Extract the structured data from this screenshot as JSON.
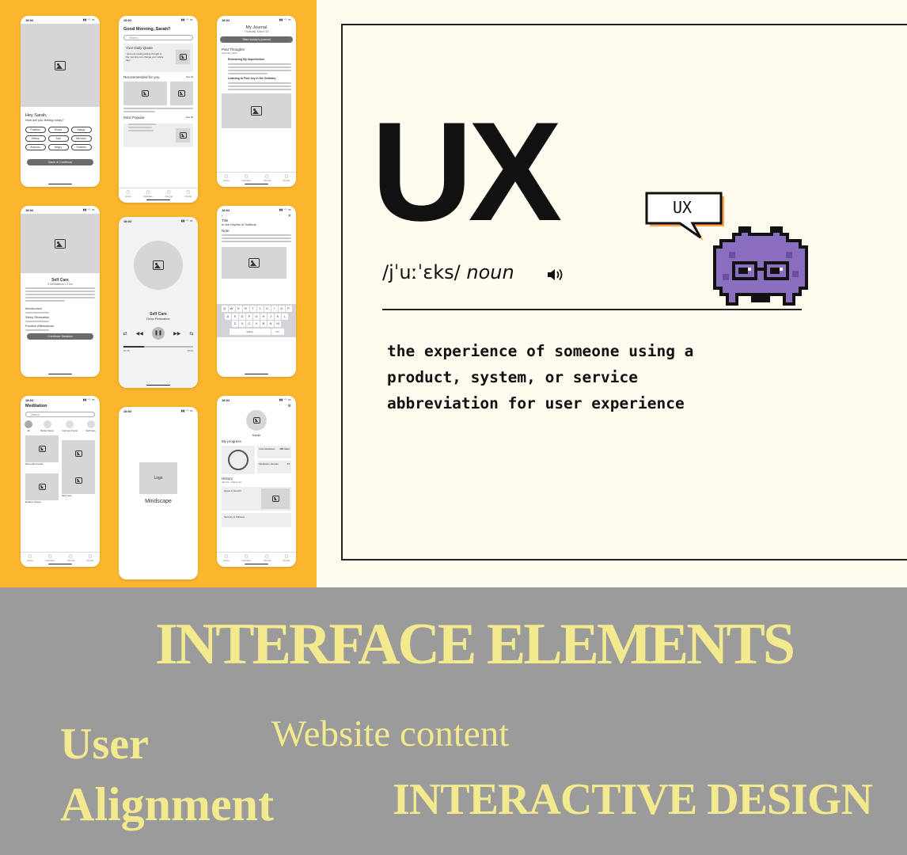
{
  "mockups": {
    "time": "18:02",
    "screen1": {
      "greeting": "Hey Sarah,",
      "question": "How are you feeling today?",
      "moods": [
        "Positive",
        "Proud",
        "Happy",
        "Stress",
        "Sad",
        "Nervous",
        "Anxious",
        "Angry",
        "Grateful"
      ],
      "button": "Save & Continue"
    },
    "screen2": {
      "greeting": "Good Morning, Sarah!!",
      "search": "Search",
      "quote_title": "Your Daily Quote",
      "quote_text": "\"Just one small positive thought in the morning can change your whole day.\"",
      "recommended": "Recommended for you",
      "see_all": "See all",
      "most_popular": "Most Popular"
    },
    "screen3": {
      "title": "My Journal",
      "date": "Thursday, March 14",
      "button": "Start today's journal",
      "past": "Past Thoughts",
      "month": "February 2023",
      "entry1": "Embracing My Imperfection",
      "entry2": "Learning to Find Joy in the Ordinary"
    },
    "screen4": {
      "title": "Self Care",
      "meta": "3 Meditations • 2 hrs",
      "items": [
        "Introduction",
        "Sleep Relaxation",
        "Positive Affirmations"
      ],
      "button": "Continue Session"
    },
    "screen5": {
      "title": "Self Care",
      "subtitle": "Deep Relaxation",
      "time_start": "03:48",
      "time_end": "08:00"
    },
    "screen6": {
      "label_title": "Title",
      "title_value": "In the Depths of Solitude",
      "label_note": "Note",
      "keys_row1": [
        "Q",
        "W",
        "E",
        "R",
        "T",
        "Y",
        "U",
        "I",
        "O",
        "P"
      ],
      "keys_row2": [
        "A",
        "S",
        "D",
        "F",
        "G",
        "H",
        "J",
        "K",
        "L"
      ],
      "keys_row3": [
        "Z",
        "X",
        "C",
        "V",
        "B",
        "N",
        "M"
      ],
      "space": "space",
      "go": "Go"
    },
    "screen7": {
      "title": "Meditation",
      "search": "Search",
      "cats": [
        "All",
        "Better Sleep",
        "Improve Focus",
        "Self Care"
      ],
      "tiles": [
        "Personal Growth",
        "Improve Sleep",
        "Reduce Stress",
        "Self Care"
      ]
    },
    "screen8": {
      "logo": "Logo",
      "app_name": "Mindscape"
    },
    "screen9": {
      "name": "Sarah",
      "progress": "My progress",
      "stat1_label": "Total Meditated",
      "stat1_value": "450 mins",
      "stat2_label": "Meditation Streaks",
      "stat2_value": "17",
      "history": "History",
      "range": "Jan 03 – March 12",
      "item1": "Quest to Growth",
      "item2": "Serenity in Stillness"
    },
    "tabs": [
      "Home",
      "Meditate",
      "Journal",
      "Profile"
    ]
  },
  "dictionary": {
    "word": "UX",
    "pronunciation": "/jˈuːˈɛks/",
    "part_of_speech": "noun",
    "bubble_text": "UX",
    "definitions": [
      "the experience of someone using a",
      "product, system, or service",
      "abbreviation for user experience"
    ]
  },
  "band": {
    "heading": "INTERFACE ELEMENTS",
    "user": "User",
    "website": "Website content",
    "alignment": "Alignment",
    "interactive": "INTERACTIVE DESIGN"
  },
  "colors": {
    "mockup_bg": "#fbb62e",
    "card_bg": "#fffbef",
    "band_bg": "#9b9b9b",
    "band_text": "#f3e98e",
    "monster_purple": "#8a6fc1"
  }
}
